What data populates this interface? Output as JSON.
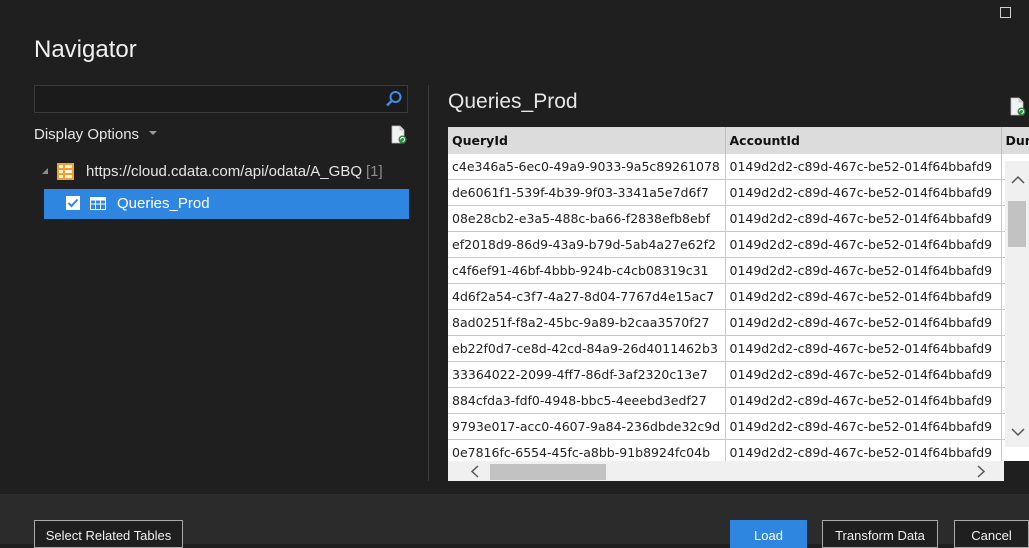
{
  "window": {
    "title": "Navigator"
  },
  "search": {
    "value": "",
    "placeholder": ""
  },
  "display_options_label": "Display Options",
  "tree": {
    "source_label": "https://cloud.cdata.com/api/odata/A_GBQ",
    "source_count": "[1]",
    "items": [
      {
        "label": "Queries_Prod",
        "checked": true,
        "selected": true
      }
    ]
  },
  "preview": {
    "title": "Queries_Prod",
    "columns": [
      "QueryId",
      "AccountId",
      "Dura"
    ],
    "rows": [
      [
        "c4e346a5-6ec0-49a9-9033-9a5c89261078",
        "0149d2d2-c89d-467c-be52-014f64bbafd9",
        ""
      ],
      [
        "de6061f1-539f-4b39-9f03-3341a5e7d6f7",
        "0149d2d2-c89d-467c-be52-014f64bbafd9",
        ""
      ],
      [
        "08e28cb2-e3a5-488c-ba66-f2838efb8ebf",
        "0149d2d2-c89d-467c-be52-014f64bbafd9",
        ""
      ],
      [
        "ef2018d9-86d9-43a9-b79d-5ab4a27e62f2",
        "0149d2d2-c89d-467c-be52-014f64bbafd9",
        ""
      ],
      [
        "c4f6ef91-46bf-4bbb-924b-c4cb08319c31",
        "0149d2d2-c89d-467c-be52-014f64bbafd9",
        ""
      ],
      [
        "4d6f2a54-c3f7-4a27-8d04-7767d4e15ac7",
        "0149d2d2-c89d-467c-be52-014f64bbafd9",
        ""
      ],
      [
        "8ad0251f-f8a2-45bc-9a89-b2caa3570f27",
        "0149d2d2-c89d-467c-be52-014f64bbafd9",
        ""
      ],
      [
        "eb22f0d7-ce8d-42cd-84a9-26d4011462b3",
        "0149d2d2-c89d-467c-be52-014f64bbafd9",
        ""
      ],
      [
        "33364022-2099-4ff7-86df-3af2320c13e7",
        "0149d2d2-c89d-467c-be52-014f64bbafd9",
        ""
      ],
      [
        "884cfda3-fdf0-4948-bbc5-4eeebd3edf27",
        "0149d2d2-c89d-467c-be52-014f64bbafd9",
        ""
      ],
      [
        "9793e017-acc0-4607-9a84-236dbde32c9d",
        "0149d2d2-c89d-467c-be52-014f64bbafd9",
        ""
      ],
      [
        "0e7816fc-6554-45fc-a8bb-91b8924fc04b",
        "0149d2d2-c89d-467c-be52-014f64bbafd9",
        ""
      ]
    ]
  },
  "buttons": {
    "select_related": "Select Related Tables",
    "load": "Load",
    "transform": "Transform Data",
    "cancel": "Cancel"
  },
  "colors": {
    "accent": "#2f86e0",
    "background": "#1f1f1f",
    "footer": "#2b2b2b"
  },
  "icons": [
    "maximize-icon",
    "search-icon",
    "refresh-icon",
    "odata-source-icon",
    "table-icon",
    "checkbox-checked-icon",
    "scroll-up-icon",
    "scroll-down-icon",
    "scroll-left-icon",
    "scroll-right-icon"
  ]
}
